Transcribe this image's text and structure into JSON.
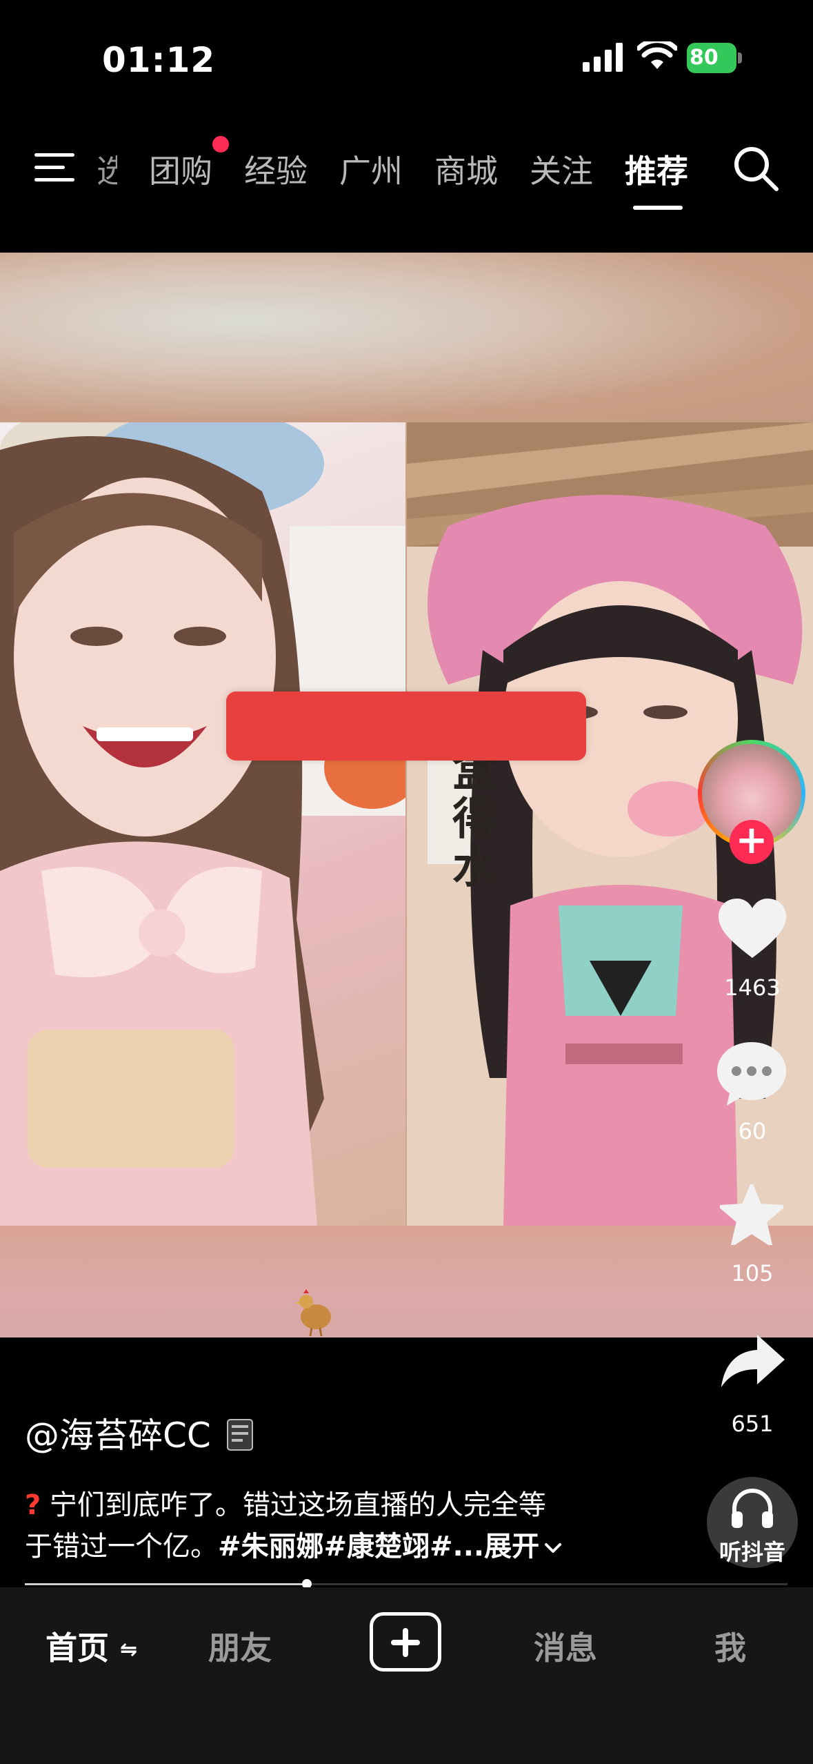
{
  "status_bar": {
    "time": "01:12",
    "battery": "80"
  },
  "top_nav": {
    "partial_tab": "选",
    "tabs": [
      {
        "label": "团购"
      },
      {
        "label": "经验"
      },
      {
        "label": "广州"
      },
      {
        "label": "商城"
      },
      {
        "label": "关注"
      },
      {
        "label": "推荐"
      }
    ],
    "active_tab": "推荐"
  },
  "video": {
    "right_panel_sign": "吃盒得水"
  },
  "actions": {
    "likes": "1463",
    "comments": "60",
    "favorites": "105",
    "shares": "651",
    "listen_label": "听抖音"
  },
  "post": {
    "author": "@海苔碎CC",
    "desc_line1": "宁们到底咋了。错过这场直播的人完全等",
    "desc_line2_text": "于错过一个亿。",
    "desc_line2_tags": "#朱丽娜#康楚翊#...",
    "expand_label": "展开"
  },
  "playback": {
    "progress": 0.37
  },
  "bottom_nav": {
    "home": "首页",
    "friends": "朋友",
    "messages": "消息",
    "me": "我"
  },
  "colors": {
    "accent_red": "#fe2c55",
    "battery_green": "#34c759",
    "background": "#000000",
    "bottom_bar": "#161616"
  }
}
